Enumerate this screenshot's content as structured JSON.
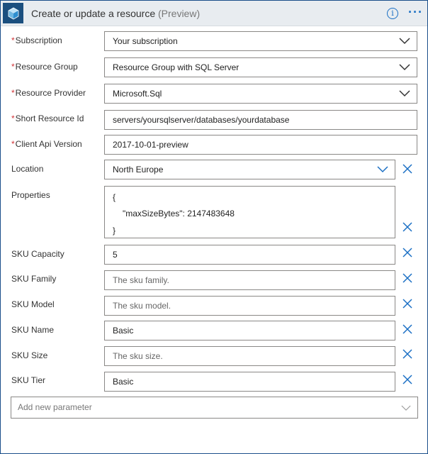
{
  "header": {
    "title": "Create or update a resource",
    "suffix": "(Preview)",
    "info_icon": "info-icon",
    "more_icon": "ellipsis-icon",
    "action_icon": "cube-icon"
  },
  "required_mark": "*",
  "fields": {
    "subscription": {
      "label": "Subscription",
      "value": "Your subscription"
    },
    "resource_group": {
      "label": "Resource Group",
      "value": "Resource Group with SQL Server"
    },
    "resource_provider": {
      "label": "Resource Provider",
      "value": "Microsoft.Sql"
    },
    "short_resource_id": {
      "label": "Short Resource Id",
      "value": "servers/yoursqlserver/databases/yourdatabase"
    },
    "client_api_version": {
      "label": "Client Api Version",
      "value": "2017-10-01-preview"
    },
    "location": {
      "label": "Location",
      "value": "North Europe"
    },
    "properties": {
      "label": "Properties",
      "line1": "{",
      "line2": "\"maxSizeBytes\": 2147483648",
      "line3": "}"
    },
    "sku_capacity": {
      "label": "SKU Capacity",
      "value": "5"
    },
    "sku_family": {
      "label": "SKU Family",
      "placeholder": "The sku family."
    },
    "sku_model": {
      "label": "SKU Model",
      "placeholder": "The sku model."
    },
    "sku_name": {
      "label": "SKU Name",
      "value": "Basic"
    },
    "sku_size": {
      "label": "SKU Size",
      "placeholder": "The sku size."
    },
    "sku_tier": {
      "label": "SKU Tier",
      "value": "Basic"
    }
  },
  "add_parameter": {
    "placeholder": "Add new parameter"
  },
  "colors": {
    "header_bg": "#e8ecf0",
    "accent": "#1a6fc4",
    "required": "#d13438",
    "icon_bg": "#1b4f7f"
  }
}
